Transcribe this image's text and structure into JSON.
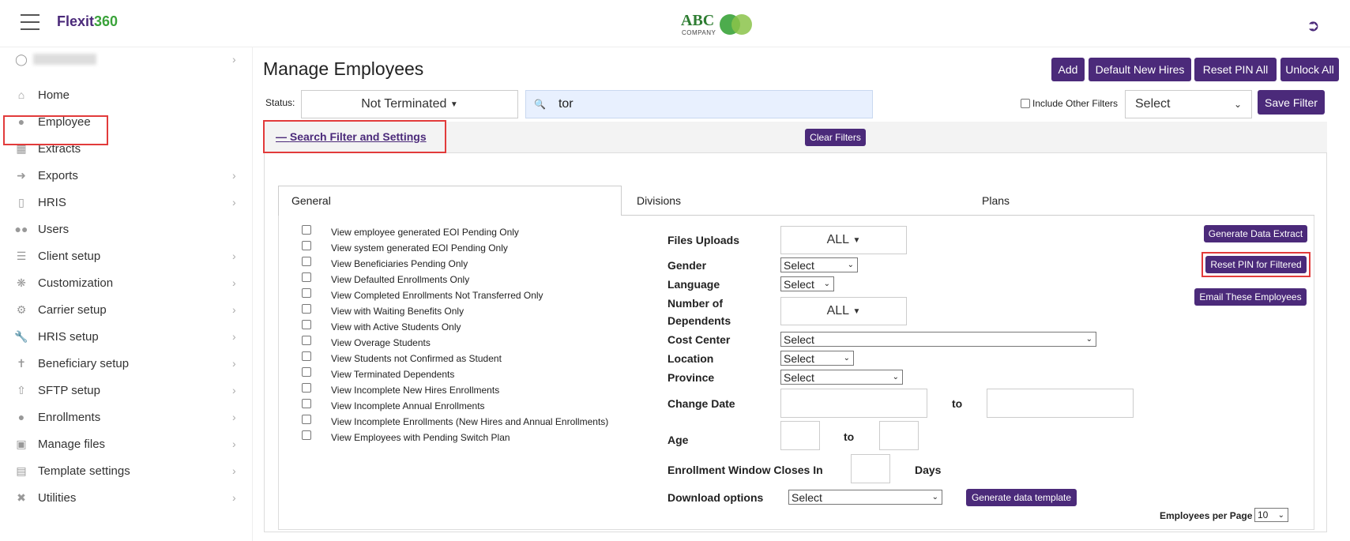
{
  "header": {
    "brand_part1": "Flexit",
    "brand_part2": "360",
    "logo_text": "ABC",
    "logo_subtext": "COMPANY"
  },
  "sidebar": {
    "items": [
      {
        "label": "Home",
        "icon": "home-icon"
      },
      {
        "label": "Employee",
        "icon": "person-icon"
      },
      {
        "label": "Extracts",
        "icon": "table-icon"
      },
      {
        "label": "Exports",
        "icon": "export-icon"
      },
      {
        "label": "HRIS",
        "icon": "file-icon"
      },
      {
        "label": "Users",
        "icon": "users-icon"
      },
      {
        "label": "Client setup",
        "icon": "sliders-icon"
      },
      {
        "label": "Customization",
        "icon": "gears-icon"
      },
      {
        "label": "Carrier setup",
        "icon": "gear-icon"
      },
      {
        "label": "HRIS setup",
        "icon": "wrench-icon"
      },
      {
        "label": "Beneficiary setup",
        "icon": "beneficiary-icon"
      },
      {
        "label": "SFTP setup",
        "icon": "upload-icon"
      },
      {
        "label": "Enrollments",
        "icon": "group-icon"
      },
      {
        "label": "Manage files",
        "icon": "file-image-icon"
      },
      {
        "label": "Template settings",
        "icon": "document-icon"
      },
      {
        "label": "Utilities",
        "icon": "tools-icon"
      }
    ]
  },
  "page": {
    "title": "Manage Employees",
    "buttons": {
      "add": "Add",
      "default_new_hires": "Default New Hires",
      "reset_pin_all": "Reset PIN All",
      "unlock_all": "Unlock All",
      "save_filter": "Save Filter"
    },
    "status_label": "Status:",
    "status_value": "Not Terminated",
    "search_value": "tor",
    "include_other_filters": "Include Other Filters",
    "filter_select": "Select"
  },
  "filter_panel": {
    "title": "Search Filter and Settings",
    "clear_filters": "Clear Filters",
    "tabs": [
      "General",
      "Divisions",
      "Plans"
    ],
    "checkbox_options": [
      "View employee generated EOI Pending Only",
      "View system generated EOI Pending Only",
      "View Beneficiaries Pending Only",
      "View Defaulted Enrollments Only",
      "View Completed Enrollments Not Transferred Only",
      "View with Waiting Benefits Only",
      "View with Active Students Only",
      "View Overage Students",
      "View Students not Confirmed as Student",
      "View Terminated Dependents",
      "View Incomplete New Hires Enrollments",
      "View Incomplete Annual Enrollments",
      "View Incomplete Enrollments (New Hires and Annual Enrollments)",
      "View Employees with Pending Switch Plan"
    ],
    "fields": {
      "files_uploads": "Files Uploads",
      "files_uploads_value": "ALL",
      "gender": "Gender",
      "gender_value": "Select",
      "language": "Language",
      "language_value": "Select",
      "num_dependents_1": "Number of",
      "num_dependents_2": "Dependents",
      "num_dependents_value": "ALL",
      "cost_center": "Cost Center",
      "cost_center_value": "Select",
      "location": "Location",
      "location_value": "Select",
      "province": "Province",
      "province_value": "Select",
      "change_date": "Change Date",
      "to": "to",
      "age": "Age",
      "enrollment_window": "Enrollment Window Closes In",
      "days": "Days",
      "download_options": "Download options",
      "download_value": "Select",
      "employees_per_page": "Employees per Page",
      "employees_per_page_value": "10"
    },
    "action_buttons": {
      "generate_data_extract": "Generate Data Extract",
      "reset_pin_filtered": "Reset PIN for Filtered",
      "email_these": "Email These Employees",
      "generate_template": "Generate data template"
    }
  },
  "colors": {
    "accent": "#4b2a7a",
    "highlight": "#e23b3b",
    "brand_green": "#3aa33a"
  }
}
